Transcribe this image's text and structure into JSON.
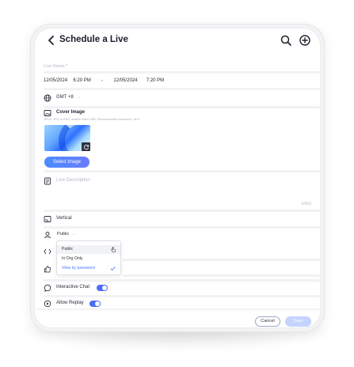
{
  "header": {
    "title": "Schedule a Live",
    "back_icon": "chevron-left-icon",
    "search_icon": "search-icon",
    "add_icon": "plus-circle-icon"
  },
  "form": {
    "live_name_placeholder": "Live Name *",
    "start_date": "12/05/2024",
    "start_time": "6:20 PM",
    "range_dash": "-",
    "end_date": "12/05/2024",
    "end_time": "7:20 PM",
    "timezone": "GMT +8",
    "cover": {
      "title": "Cover Image",
      "hint": "JPEG, JPG or PNG, smaller than 5 MB. Recommended resolution: 16:9.",
      "select_button": "Select Image"
    },
    "description_placeholder": "Live Description",
    "description_counter": "0/500",
    "orientation_label": "Vertical",
    "visibility": {
      "selected": "Public",
      "options": [
        "Public",
        "In Org Only",
        "View by password"
      ],
      "checked_option": "View by password"
    },
    "interactive_chat": {
      "label": "Interactive Chat",
      "enabled": true
    },
    "allow_replay": {
      "label": "Allow Replay",
      "enabled": true
    }
  },
  "footer": {
    "cancel": "Cancel",
    "save": "Save"
  },
  "colors": {
    "accent": "#4a6cf7",
    "select_button": "#5a84ff",
    "save_disabled": "#c5d3ff",
    "dropdown_selected": "#4a7bff"
  }
}
